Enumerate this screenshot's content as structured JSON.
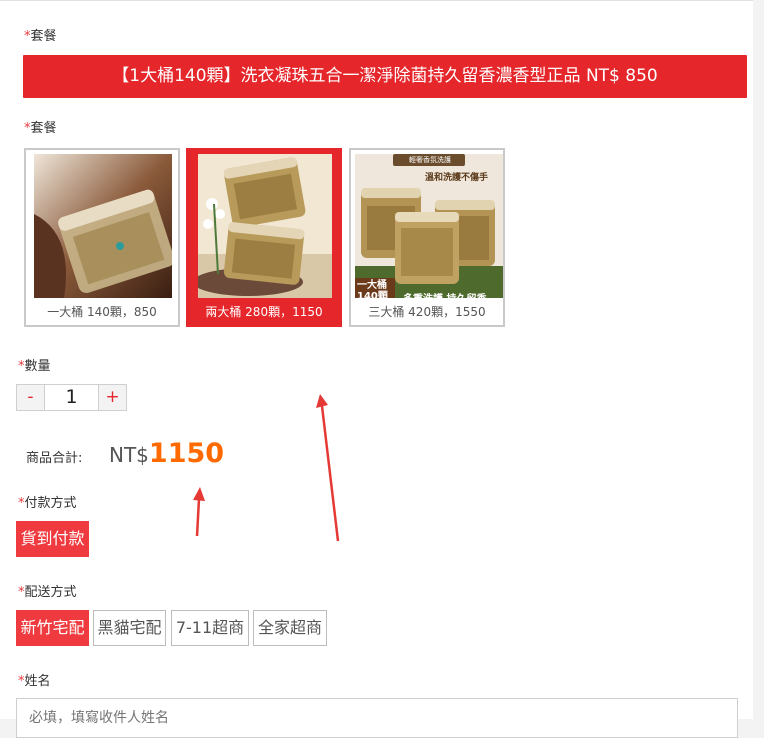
{
  "package_label_1": "套餐",
  "banner": "【1大桶140顆】洗衣凝珠五合一潔淨除菌持久留香濃香型正品 NT$ 850",
  "package_label_2": "套餐",
  "packages": [
    {
      "caption": "一大桶 140顆，850",
      "selected": false,
      "img_text": "",
      "img_text2": ""
    },
    {
      "caption": "兩大桶 280顆，1150",
      "selected": true,
      "img_text": "",
      "img_text2": ""
    },
    {
      "caption": "三大桶 420顆，1550",
      "selected": false,
      "img_text": "一大桶\n140顆",
      "img_text2": "多重洗護 持久留香"
    }
  ],
  "package3_tag": "輕奢香氛洗護",
  "package3_tag2": "溫和洗護不傷手",
  "quantity_label": "數量",
  "quantity": {
    "minus": "-",
    "value": "1",
    "plus": "+"
  },
  "total_label": "商品合計:",
  "total_currency": "NT$",
  "total_value": "1150",
  "payment_label": "付款方式",
  "payment_options": [
    "貨到付款"
  ],
  "shipping_label": "配送方式",
  "shipping_options": [
    "新竹宅配",
    "黑貓宅配",
    "7-11超商",
    "全家超商"
  ],
  "name_label": "姓名",
  "name_placeholder": "必填，填寫收件人姓名",
  "required_mark": "*",
  "colors": {
    "accent": "#e5262b",
    "price": "#ff6a00",
    "arrow": "#e53935"
  }
}
